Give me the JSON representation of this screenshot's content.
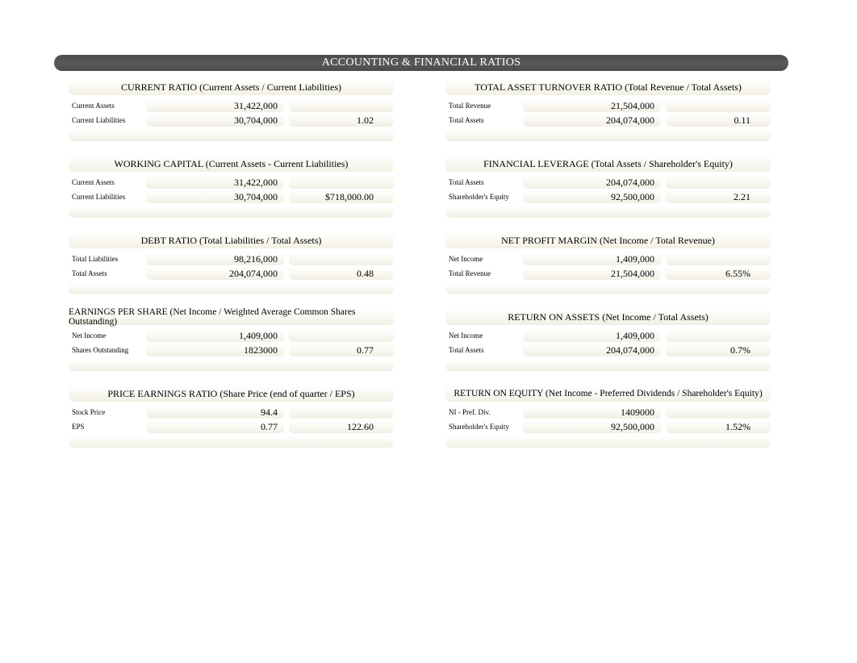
{
  "header": {
    "title": "ACCOUNTING & FINANCIAL RATIOS"
  },
  "left": [
    {
      "title": "CURRENT RATIO (Current Assets / Current Liabilities)",
      "rows": [
        {
          "label": "Current Assets",
          "value": "31,422,000",
          "result": ""
        },
        {
          "label": "Current Liabilities",
          "value": "30,704,000",
          "result": "1.02"
        }
      ]
    },
    {
      "title": "WORKING CAPITAL (Current Assets - Current Liabilities)",
      "rows": [
        {
          "label": "Current Assets",
          "value": "31,422,000",
          "result": ""
        },
        {
          "label": "Current Liabilities",
          "value": "30,704,000",
          "result": "$718,000.00"
        }
      ]
    },
    {
      "title": "DEBT RATIO (Total Liabilities / Total Assets)",
      "rows": [
        {
          "label": "Total Liabilities",
          "value": "98,216,000",
          "result": ""
        },
        {
          "label": "Total Assets",
          "value": "204,074,000",
          "result": "0.48"
        }
      ]
    },
    {
      "title": "EARNINGS PER SHARE (Net Income / Weighted Average Common Shares Outstanding)",
      "rows": [
        {
          "label": "Net Income",
          "value": "1,409,000",
          "result": ""
        },
        {
          "label": "Shares Outstanding",
          "value": "1823000",
          "result": "0.77"
        }
      ]
    },
    {
      "title": "PRICE EARNINGS RATIO (Share Price (end of quarter / EPS)",
      "rows": [
        {
          "label": "Stock Price",
          "value": "94.4",
          "result": ""
        },
        {
          "label": "EPS",
          "value": "0.77",
          "result": "122.60"
        }
      ]
    }
  ],
  "right": [
    {
      "title": "TOTAL ASSET TURNOVER RATIO (Total Revenue / Total Assets)",
      "rows": [
        {
          "label": "Total Revenue",
          "value": "21,504,000",
          "result": ""
        },
        {
          "label": "Total Assets",
          "value": "204,074,000",
          "result": "0.11"
        }
      ]
    },
    {
      "title": "FINANCIAL LEVERAGE (Total Assets / Shareholder's Equity)",
      "rows": [
        {
          "label": "Total Assets",
          "value": "204,074,000",
          "result": ""
        },
        {
          "label": "Shareholder's Equity",
          "value": "92,500,000",
          "result": "2.21"
        }
      ]
    },
    {
      "title": "NET PROFIT MARGIN (Net Income / Total Revenue)",
      "rows": [
        {
          "label": "Net Income",
          "value": "1,409,000",
          "result": ""
        },
        {
          "label": "Total Revenue",
          "value": "21,504,000",
          "result": "6.55%"
        }
      ]
    },
    {
      "title": "RETURN ON ASSETS (Net Income / Total Assets)",
      "rows": [
        {
          "label": "Net Income",
          "value": "1,409,000",
          "result": ""
        },
        {
          "label": "Total Assets",
          "value": "204,074,000",
          "result": "0.7%"
        }
      ]
    },
    {
      "title": "RETURN ON EQUITY (Net Income - Preferred Dividends / Shareholder's Equity)",
      "rows": [
        {
          "label": "NI - Pref. Div.",
          "value": "1409000",
          "result": ""
        },
        {
          "label": "Shareholder's Equity",
          "value": "92,500,000",
          "result": "1.52%"
        }
      ]
    }
  ]
}
